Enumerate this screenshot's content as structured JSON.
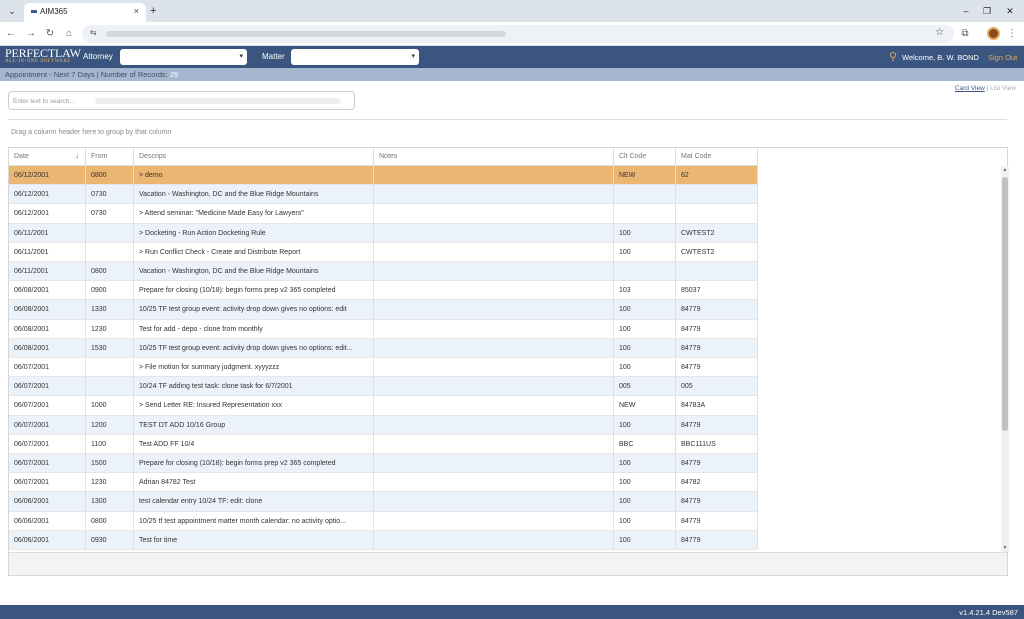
{
  "browser": {
    "tab_title": "AIM365",
    "tab_close": "×",
    "new_tab": "+",
    "menu_glyph": "⌄",
    "win_min": "–",
    "win_max": "❐",
    "win_close": "✕",
    "back": "←",
    "forward": "→",
    "reload": "↻",
    "home": "⌂",
    "site_info": "⇆",
    "star": "☆",
    "extensions": "⧉",
    "more": "⋮"
  },
  "app": {
    "logo_main": "PERFECTLAW",
    "logo_sub": "ALL-IN-ONE SOFTWARE",
    "attorney_label": "Attorney",
    "matter_label": "Matter",
    "attorney_value": "",
    "matter_value": "",
    "caret": "▾",
    "welcome": "Welcome, B. W. BOND",
    "sign_out": "Sign Out",
    "search_glyph": "⚲"
  },
  "subbar": {
    "title": "Appointment - Next 7 Days | Number of Records: ",
    "count": "29"
  },
  "views": {
    "card": "Card View",
    "separator": " | ",
    "list": "List View"
  },
  "search": {
    "placeholder": "Enter text to search..."
  },
  "group_hint": "Drag a column header here to group by that column",
  "columns": {
    "date": "Date",
    "from": "From",
    "descrips": "Descrips",
    "notes": "Notes",
    "clt_code": "Clt Code",
    "mat_code": "Mat Code",
    "sort_glyph": "↓"
  },
  "rows": [
    {
      "date": "06/12/2001",
      "from": "0800",
      "descrips": "> demo",
      "notes": "",
      "clt": "NEW",
      "mat": "62"
    },
    {
      "date": "06/12/2001",
      "from": "0730",
      "descrips": "Vacation - Washington, DC and the Blue Ridge Mountains",
      "notes": "",
      "clt": "",
      "mat": ""
    },
    {
      "date": "06/12/2001",
      "from": "0730",
      "descrips": "> Attend seminar: \"Medicine Made Easy for Lawyers\"",
      "notes": "",
      "clt": "",
      "mat": ""
    },
    {
      "date": "06/11/2001",
      "from": "",
      "descrips": "> Docketing - Run Action Docketing Rule",
      "notes": "",
      "clt": "100",
      "mat": "CWTEST2"
    },
    {
      "date": "06/11/2001",
      "from": "",
      "descrips": "> Run Conflict Check - Create and Distribute Report",
      "notes": "",
      "clt": "100",
      "mat": "CWTEST2"
    },
    {
      "date": "06/11/2001",
      "from": "0800",
      "descrips": "Vacation - Washington, DC and the Blue Ridge Mountains",
      "notes": "",
      "clt": "",
      "mat": ""
    },
    {
      "date": "06/08/2001",
      "from": "0900",
      "descrips": "Prepare for closing (10/18): begin forms prep v2 365 completed",
      "notes": "",
      "clt": "103",
      "mat": "85037"
    },
    {
      "date": "06/08/2001",
      "from": "1330",
      "descrips": "10/25 TF test group event: activity drop down gives no options: edit",
      "notes": "",
      "clt": "100",
      "mat": "84779"
    },
    {
      "date": "06/08/2001",
      "from": "1230",
      "descrips": "Test for add - depo - clone from monthly",
      "notes": "",
      "clt": "100",
      "mat": "84779"
    },
    {
      "date": "06/08/2001",
      "from": "1530",
      "descrips": "10/25 TF test group event: activity drop down gives no options: edit...",
      "notes": "",
      "clt": "100",
      "mat": "84779"
    },
    {
      "date": "06/07/2001",
      "from": "",
      "descrips": "> File motion for summary judgment. xyyyzzz",
      "notes": "",
      "clt": "100",
      "mat": "84779"
    },
    {
      "date": "06/07/2001",
      "from": "",
      "descrips": "10/24 TF adding test task: clone task for 6/7/2001",
      "notes": "",
      "clt": "005",
      "mat": "005"
    },
    {
      "date": "06/07/2001",
      "from": "1000",
      "descrips": "> Send Letter RE: Insured Representation xxx",
      "notes": "",
      "clt": "NEW",
      "mat": "84783A"
    },
    {
      "date": "06/07/2001",
      "from": "1200",
      "descrips": "TEST DT ADD 10/16 Group",
      "notes": "",
      "clt": "100",
      "mat": "84779"
    },
    {
      "date": "06/07/2001",
      "from": "1100",
      "descrips": "Test ADD FF 10/4",
      "notes": "",
      "clt": "BBC",
      "mat": "BBC111US"
    },
    {
      "date": "06/07/2001",
      "from": "1500",
      "descrips": "Prepare for closing (10/18): begin forms prep v2 365 completed",
      "notes": "",
      "clt": "100",
      "mat": "84779"
    },
    {
      "date": "06/07/2001",
      "from": "1230",
      "descrips": "Adrian 84782 Test",
      "notes": "",
      "clt": "100",
      "mat": "84782"
    },
    {
      "date": "06/06/2001",
      "from": "1300",
      "descrips": "test calendar entry 10/24 TF: edit: clone",
      "notes": "",
      "clt": "100",
      "mat": "84779"
    },
    {
      "date": "06/06/2001",
      "from": "0800",
      "descrips": "10/25 tf test appointment matter month calendar: no activity optio...",
      "notes": "",
      "clt": "100",
      "mat": "84779"
    },
    {
      "date": "06/06/2001",
      "from": "0930",
      "descrips": "Test for time",
      "notes": "",
      "clt": "100",
      "mat": "84779"
    }
  ],
  "scroll": {
    "up": "▲",
    "down": "▼"
  },
  "version": "v1.4.21.4 Dev587",
  "colors": {
    "header_bg": "#3a5680",
    "accent": "#e8a84a",
    "selected_row": "#ebb572",
    "alt_row": "#ecf2f9"
  }
}
